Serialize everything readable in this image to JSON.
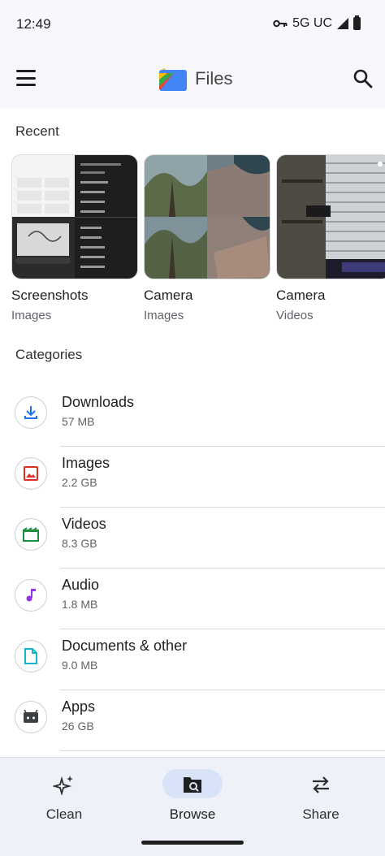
{
  "status": {
    "time": "12:49",
    "network": "5G UC"
  },
  "appbar": {
    "title": "Files"
  },
  "recent": {
    "title": "Recent",
    "items": [
      {
        "label": "Screenshots",
        "sub": "Images"
      },
      {
        "label": "Camera",
        "sub": "Images"
      },
      {
        "label": "Camera",
        "sub": "Videos"
      }
    ]
  },
  "categories": {
    "title": "Categories",
    "items": [
      {
        "name": "Downloads",
        "size": "57 MB",
        "icon": "download-icon",
        "color": "#1a73e8"
      },
      {
        "name": "Images",
        "size": "2.2 GB",
        "icon": "image-icon",
        "color": "#d93025"
      },
      {
        "name": "Videos",
        "size": "8.3 GB",
        "icon": "video-icon",
        "color": "#1e8e3e"
      },
      {
        "name": "Audio",
        "size": "1.8 MB",
        "icon": "music-icon",
        "color": "#9334e6"
      },
      {
        "name": "Documents & other",
        "size": "9.0 MB",
        "icon": "document-icon",
        "color": "#12b5cb"
      },
      {
        "name": "Apps",
        "size": "26 GB",
        "icon": "android-icon",
        "color": "#3c4043"
      }
    ]
  },
  "bottom_nav": {
    "items": [
      {
        "label": "Clean",
        "icon": "sparkle-icon"
      },
      {
        "label": "Browse",
        "icon": "browse-icon",
        "active": true
      },
      {
        "label": "Share",
        "icon": "swap-icon"
      }
    ]
  }
}
